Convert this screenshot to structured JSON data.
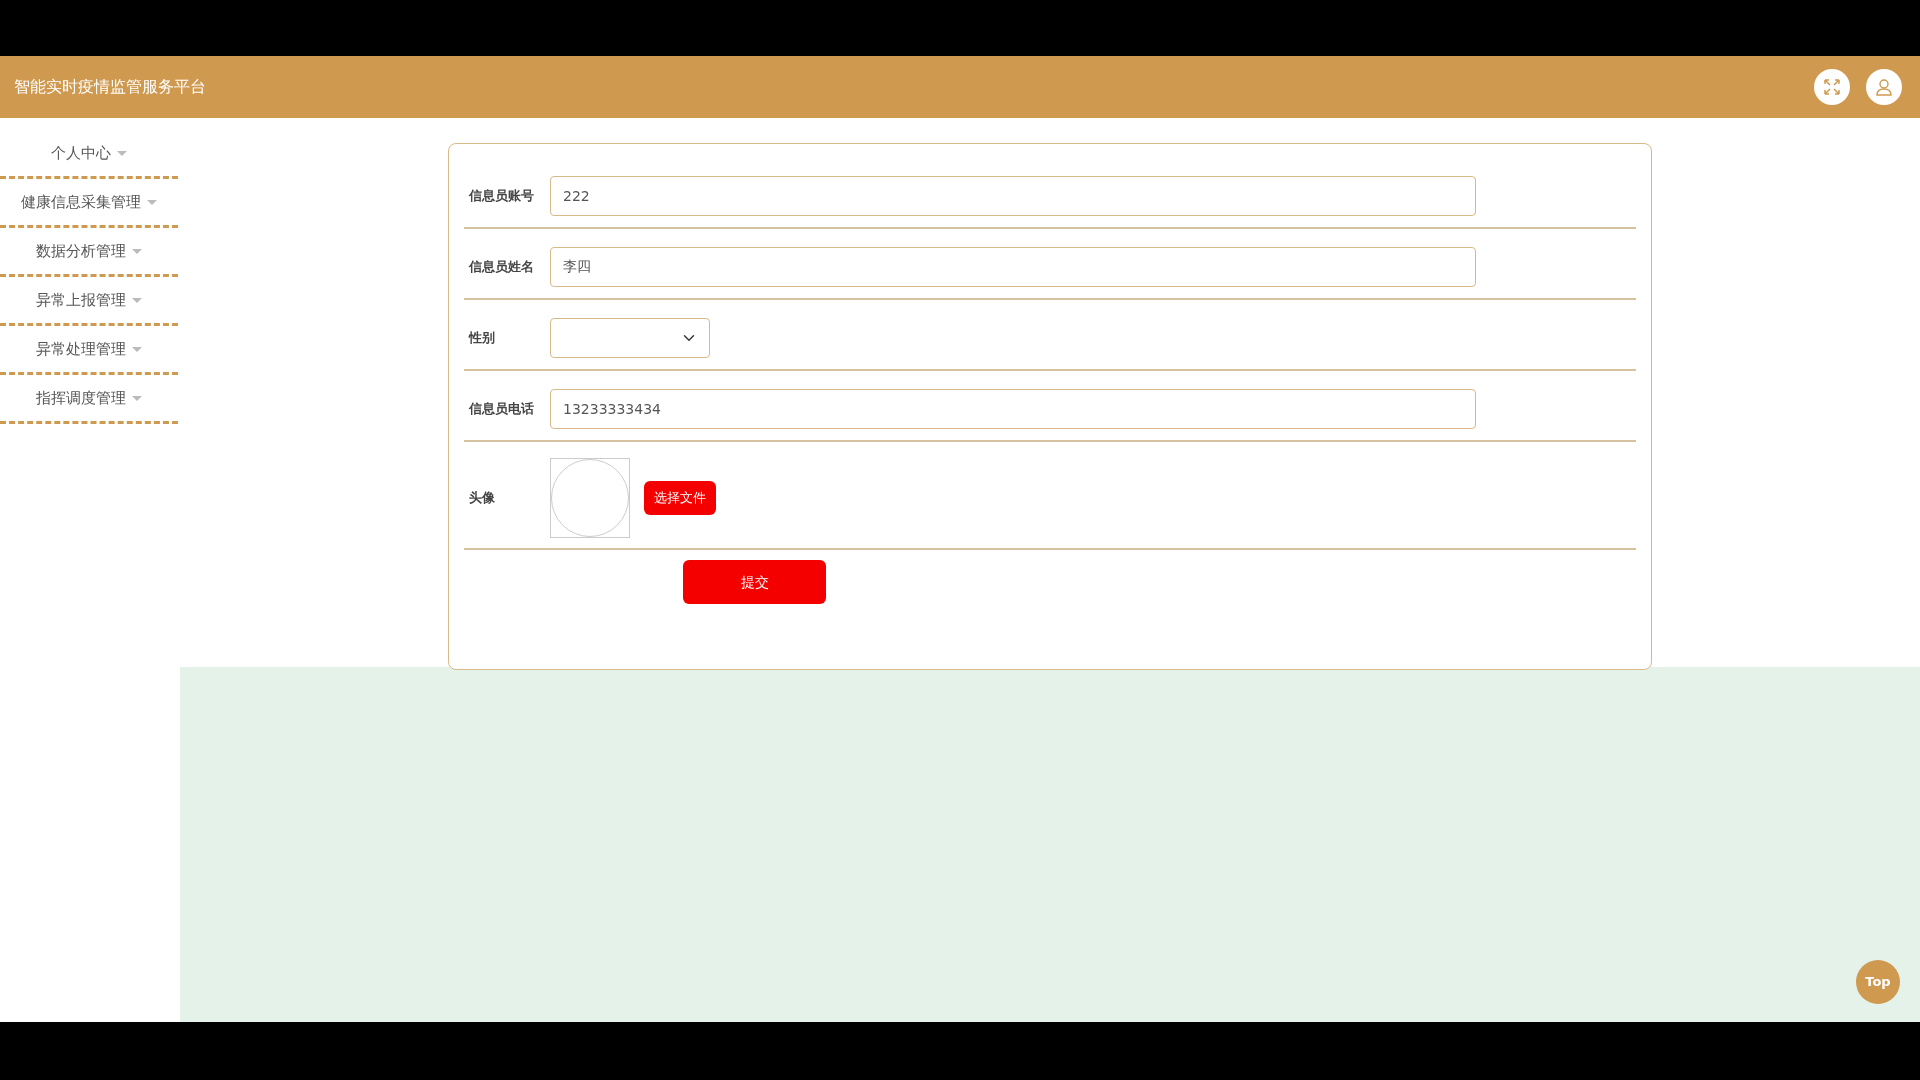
{
  "header": {
    "title": "智能实时疫情监管服务平台"
  },
  "sidebar": {
    "items": [
      {
        "label": "个人中心"
      },
      {
        "label": "健康信息采集管理"
      },
      {
        "label": "数据分析管理"
      },
      {
        "label": "异常上报管理"
      },
      {
        "label": "异常处理管理"
      },
      {
        "label": "指挥调度管理"
      }
    ]
  },
  "form": {
    "fields": [
      {
        "kind": "text",
        "label": "信息员账号",
        "value": "222"
      },
      {
        "kind": "text",
        "label": "信息员姓名",
        "value": "李四"
      },
      {
        "kind": "select",
        "label": "性别"
      },
      {
        "kind": "text",
        "label": "信息员电话",
        "value": "13233333434"
      },
      {
        "kind": "image",
        "label": "头像",
        "button": "选择文件"
      }
    ],
    "submit": "提交"
  },
  "back_to_top": "Top"
}
